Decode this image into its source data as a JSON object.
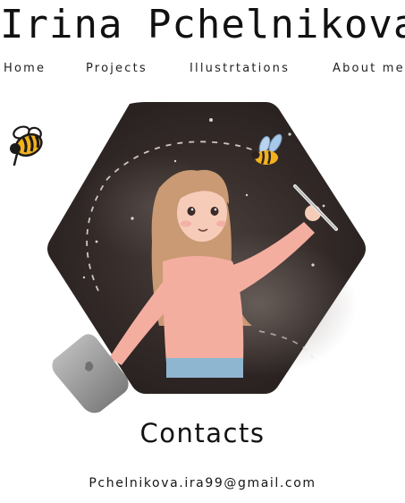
{
  "site": {
    "title": "Irina Pchelnikova"
  },
  "nav": {
    "items": [
      {
        "label": "Home"
      },
      {
        "label": "Projects"
      },
      {
        "label": "Illustrtations"
      },
      {
        "label": "About me"
      }
    ]
  },
  "icons": {
    "logo": "bee-icon",
    "hero": "hexagon-illustration"
  },
  "contacts": {
    "heading": "Contacts",
    "email": "Pchelnikova.ira99@gmail.com"
  },
  "colors": {
    "background": "#ffffff",
    "text": "#1c1a19",
    "hero_bg": "#2e2624",
    "sweater": "#f4aea0",
    "hair": "#c99a73",
    "bee_yellow": "#f2b21d"
  }
}
